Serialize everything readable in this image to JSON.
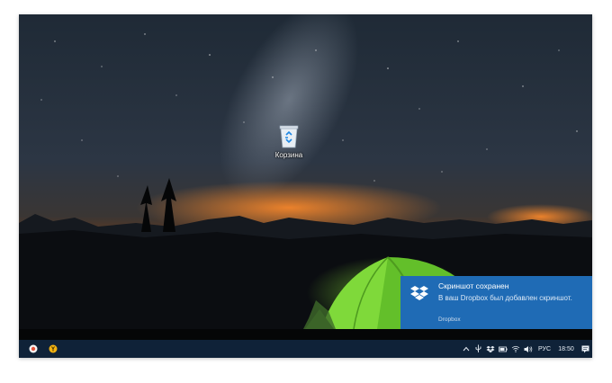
{
  "desktop": {
    "icons": [
      {
        "label": "Корзина",
        "icon": "recycle-bin-icon"
      }
    ]
  },
  "notification": {
    "app_icon": "dropbox-icon",
    "title": "Скриншот сохранен",
    "body": "В ваш Dropbox был добавлен скриншот.",
    "source": "Dropbox",
    "accent_color": "#1f6bb5"
  },
  "taskbar": {
    "pinned": [
      {
        "icon": "browser-app-icon"
      },
      {
        "icon": "yandex-app-icon"
      }
    ],
    "tray": {
      "icons": [
        "chevron-up-icon",
        "usb-icon",
        "dropbox-tray-icon",
        "battery-icon",
        "wifi-icon",
        "volume-icon"
      ],
      "language": "РУС",
      "time": "18:50",
      "action_center_icon": "action-center-icon"
    },
    "background": "#0f2238"
  }
}
